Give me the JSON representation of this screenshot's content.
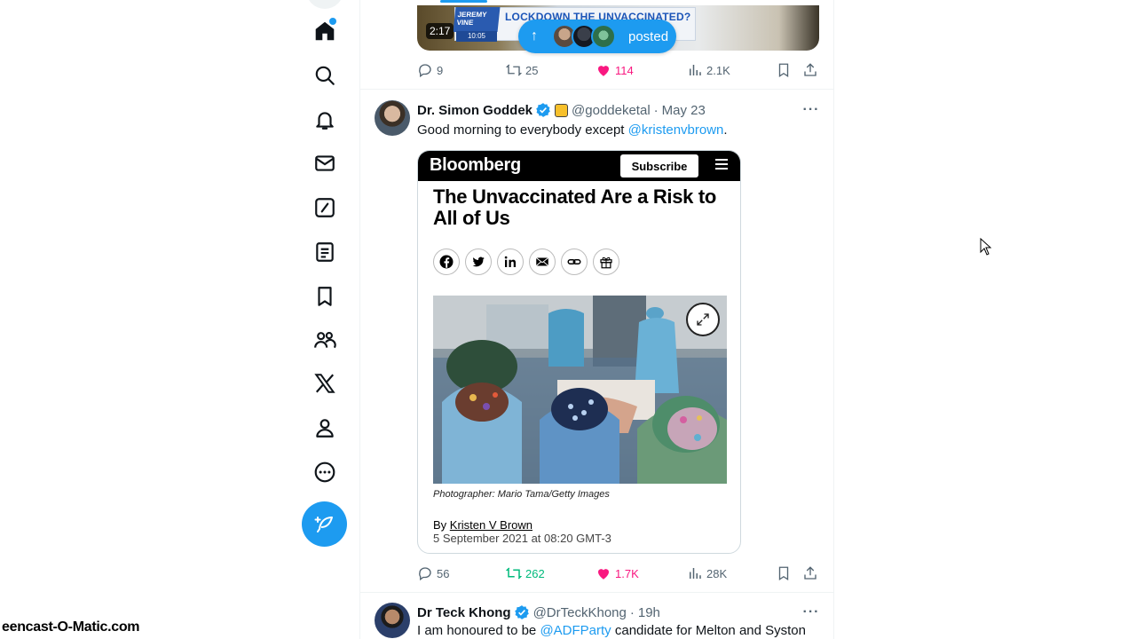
{
  "nav": {
    "items": [
      {
        "name": "nav-home",
        "icon": "home-icon",
        "has_dot": true
      },
      {
        "name": "nav-explore",
        "icon": "search-icon"
      },
      {
        "name": "nav-notifications",
        "icon": "bell-icon"
      },
      {
        "name": "nav-messages",
        "icon": "mail-icon"
      },
      {
        "name": "nav-grok",
        "icon": "grok-slash-icon"
      },
      {
        "name": "nav-lists",
        "icon": "list-icon"
      },
      {
        "name": "nav-bookmarks",
        "icon": "bookmark-icon"
      },
      {
        "name": "nav-communities",
        "icon": "people-icon"
      },
      {
        "name": "nav-premium",
        "icon": "x-logo-icon"
      },
      {
        "name": "nav-profile",
        "icon": "user-icon"
      },
      {
        "name": "nav-more",
        "icon": "more-circle-icon"
      }
    ],
    "post_button_icon": "feather-plus-icon"
  },
  "posted_pill": {
    "label": "posted",
    "arrow": "↑"
  },
  "prev_tweet": {
    "video_duration": "2:17",
    "media_headline": "LOCKDOWN THE UNVACCINATED?",
    "media_logo": "JEREMY VINE",
    "media_time": "10:05",
    "stats": {
      "replies": "9",
      "reposts": "25",
      "likes": "114",
      "views": "2.1K"
    }
  },
  "tweet1": {
    "display_name": "Dr. Simon Goddek",
    "handle": "@goddeketal",
    "date": "May 23",
    "text_before": "Good morning to everybody except ",
    "mention": "@kristenvbrown",
    "text_after": ".",
    "card": {
      "brand": "Bloomberg",
      "subscribe": "Subscribe",
      "title": "The Unvaccinated Are a Risk to All of Us",
      "caption": "Photographer: Mario Tama/Getty Images",
      "by_prefix": "By ",
      "author": "Kristen V Brown",
      "date": "5 September 2021 at 08:20 GMT-3"
    },
    "stats": {
      "replies": "56",
      "reposts": "262",
      "likes": "1.7K",
      "views": "28K"
    }
  },
  "tweet2": {
    "display_name": "Dr Teck Khong",
    "handle": "@DrTeckKhong",
    "date": "19h",
    "text_before": "I am honoured to be ",
    "mention": "@ADFParty",
    "text_after": " candidate for Melton and Syston"
  },
  "watermark": "eencast-O-Matic.com",
  "colors": {
    "accent": "#1d9bf0",
    "like": "#f91880",
    "repost": "#00ba7c",
    "muted": "#536471"
  }
}
